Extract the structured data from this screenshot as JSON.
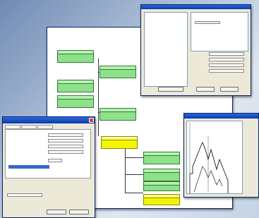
{
  "flowchart_window": {
    "nodes": [
      {},
      {},
      {},
      {},
      {},
      {},
      {},
      {},
      {},
      {},
      {}
    ]
  },
  "properties_window": {
    "title": "",
    "tree_items": [
      "",
      "",
      "",
      "",
      "",
      "",
      ""
    ],
    "fields": [
      {
        "label": ""
      },
      {
        "label": ""
      },
      {
        "label": ""
      },
      {
        "label": ""
      }
    ],
    "buttons": [
      "",
      "",
      ""
    ]
  },
  "dialog_window": {
    "title": "",
    "tabs": [
      "",
      "",
      ""
    ],
    "rows": [
      "",
      "",
      "",
      "",
      "",
      ""
    ],
    "footer_text": "",
    "buttons": [
      "",
      ""
    ]
  },
  "monitor_window": {
    "title": ""
  },
  "colors": {
    "node_green": "#8fe08a",
    "node_yellow": "#f4f400",
    "titlebar": "#0a3ca8"
  }
}
